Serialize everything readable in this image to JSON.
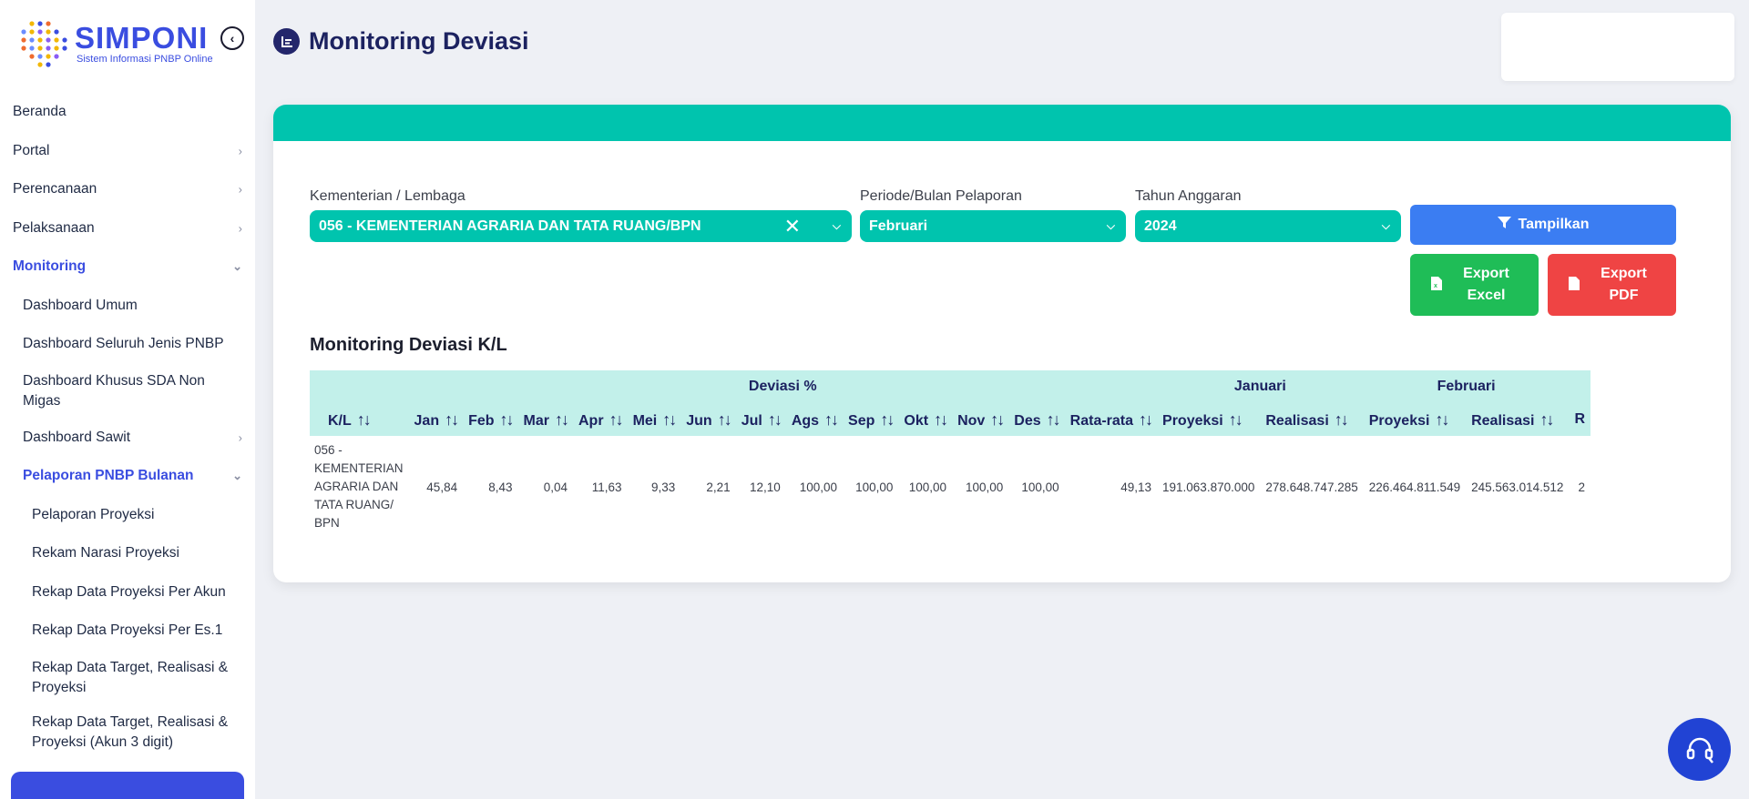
{
  "app": {
    "logo_title": "SIMPONI",
    "logo_subtitle": "Sistem Informasi PNBP Online"
  },
  "sidebar": {
    "items": [
      {
        "label": "Beranda",
        "level": 1,
        "chevron": false
      },
      {
        "label": "Portal",
        "level": 1,
        "chevron": "right"
      },
      {
        "label": "Perencanaan",
        "level": 1,
        "chevron": "right"
      },
      {
        "label": "Pelaksanaan",
        "level": 1,
        "chevron": "right"
      },
      {
        "label": "Monitoring",
        "level": 1,
        "chevron": "down",
        "active": true
      },
      {
        "label": "Dashboard Umum",
        "level": 2
      },
      {
        "label": "Dashboard Seluruh Jenis PNBP",
        "level": 2
      },
      {
        "label": "Dashboard Khusus SDA Non Migas",
        "level": 2
      },
      {
        "label": "Dashboard Sawit",
        "level": 2,
        "chevron": "right"
      },
      {
        "label": "Pelaporan PNBP Bulanan",
        "level": 2,
        "chevron": "down",
        "active": true
      },
      {
        "label": "Pelaporan Proyeksi",
        "level": 3
      },
      {
        "label": "Rekam Narasi Proyeksi",
        "level": 3
      },
      {
        "label": "Rekap Data Proyeksi Per Akun",
        "level": 3
      },
      {
        "label": "Rekap Data Proyeksi Per Es.1",
        "level": 3
      },
      {
        "label": "Rekap Data Target, Realisasi & Proyeksi",
        "level": 3
      },
      {
        "label": "Rekap Data Target, Realisasi & Proyeksi (Akun 3 digit)",
        "level": 3
      }
    ]
  },
  "page": {
    "title": "Monitoring Deviasi"
  },
  "filters": {
    "kl_label": "Kementerian / Lembaga",
    "kl_value": "056 - KEMENTERIAN AGRARIA DAN TATA RUANG/BPN",
    "periode_label": "Periode/Bulan Pelaporan",
    "periode_value": "Februari",
    "tahun_label": "Tahun Anggaran",
    "tahun_value": "2024"
  },
  "buttons": {
    "show": "Tampilkan",
    "export_excel": "Export Excel",
    "export_pdf": "Export PDF"
  },
  "table": {
    "title": "Monitoring Deviasi K/L",
    "group_headers": {
      "deviasi": "Deviasi %",
      "januari": "Januari",
      "februari": "Februari"
    },
    "columns": [
      "K/L",
      "Jan",
      "Feb",
      "Mar",
      "Apr",
      "Mei",
      "Jun",
      "Jul",
      "Ags",
      "Sep",
      "Okt",
      "Nov",
      "Des",
      "Rata-rata",
      "Proyeksi",
      "Realisasi",
      "Proyeksi",
      "Realisasi",
      "R"
    ],
    "rows": [
      [
        "056 - KEMENTERIAN AGRARIA DAN TATA RUANG/ BPN",
        "45,84",
        "8,43",
        "0,04",
        "11,63",
        "9,33",
        "2,21",
        "12,10",
        "100,00",
        "100,00",
        "100,00",
        "100,00",
        "100,00",
        "49,13",
        "191.063.870.000",
        "278.648.747.285",
        "226.464.811.549",
        "245.563.014.512",
        "2"
      ]
    ]
  },
  "colors": {
    "accent_teal": "#00c4ae",
    "primary_blue": "#3b7df2",
    "excel_green": "#1fbd57",
    "pdf_red": "#ef4444",
    "brand_indigo": "#3a4de0"
  }
}
